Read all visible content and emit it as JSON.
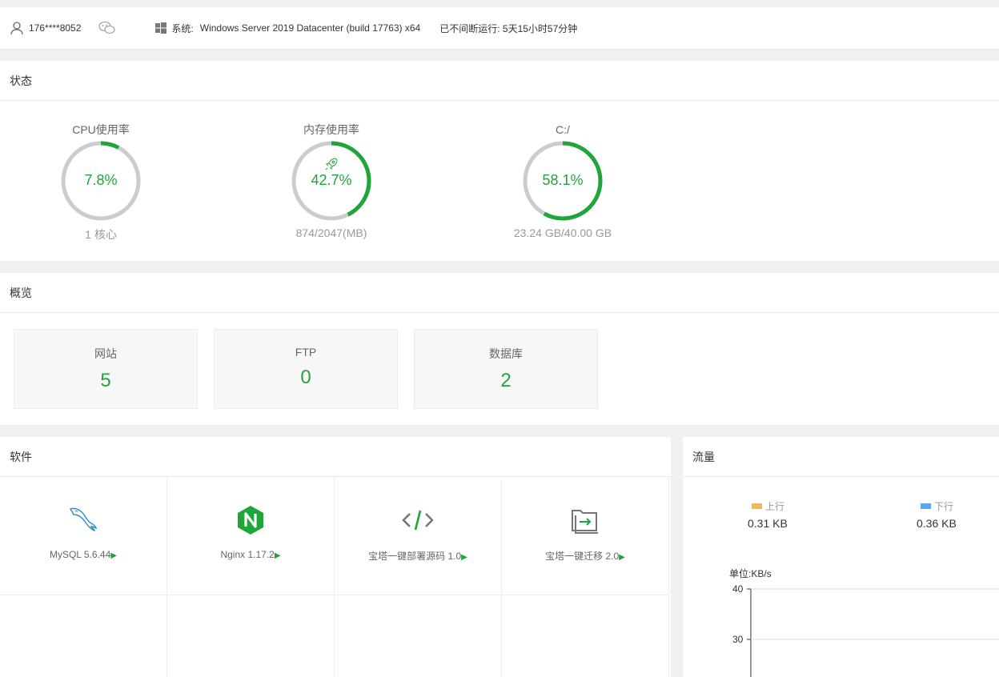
{
  "topbar": {
    "user": "176****8052",
    "system_label": "系统:",
    "system_value": "Windows Server 2019 Datacenter (build 17763) x64",
    "uptime": "已不间断运行: 5天15小时57分钟"
  },
  "status": {
    "title": "状态",
    "gauges": [
      {
        "title": "CPU使用率",
        "percent": "7.8%",
        "value": 7.8,
        "sub": "1 核心"
      },
      {
        "title": "内存使用率",
        "percent": "42.7%",
        "value": 42.7,
        "sub": "874/2047(MB)"
      },
      {
        "title": "C:/",
        "percent": "58.1%",
        "value": 58.1,
        "sub": "23.24 GB/40.00 GB"
      }
    ]
  },
  "overview": {
    "title": "概览",
    "items": [
      {
        "label": "网站",
        "value": "5"
      },
      {
        "label": "FTP",
        "value": "0"
      },
      {
        "label": "数据库",
        "value": "2"
      }
    ]
  },
  "software": {
    "title": "软件",
    "items": [
      {
        "name": "MySQL 5.6.44",
        "icon": "mysql-dolphin-icon"
      },
      {
        "name": "Nginx 1.17.2",
        "icon": "nginx-icon"
      },
      {
        "name": "宝塔一键部署源码 1.0",
        "icon": "code-icon"
      },
      {
        "name": "宝塔一键迁移 2.0",
        "icon": "migrate-icon"
      }
    ]
  },
  "traffic": {
    "title": "流量",
    "up_label": "上行",
    "up_value": "0.31 KB",
    "down_label": "下行",
    "down_value": "0.36 KB",
    "unit": "单位:KB/s",
    "ticks": [
      "40",
      "30"
    ],
    "up_color": "#f7b851",
    "down_color": "#52a9ff"
  },
  "colors": {
    "accent": "#20a53a",
    "track": "#cccccc"
  }
}
